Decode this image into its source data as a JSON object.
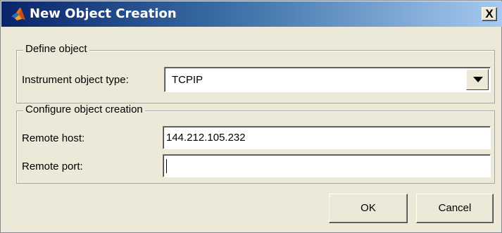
{
  "window": {
    "title": "New Object Creation",
    "close_label": "X"
  },
  "define_group": {
    "label": "Define object",
    "type_label": "Instrument object type:",
    "type_value": "TCPIP"
  },
  "configure_group": {
    "label": "Configure object creation",
    "host_label": "Remote host:",
    "host_value": "144.212.105.232",
    "port_label": "Remote port:",
    "port_value": ""
  },
  "buttons": {
    "ok": "OK",
    "cancel": "Cancel"
  },
  "icons": {
    "app": "matlab-icon",
    "dropdown": "chevron-down-icon",
    "close": "close-icon"
  }
}
